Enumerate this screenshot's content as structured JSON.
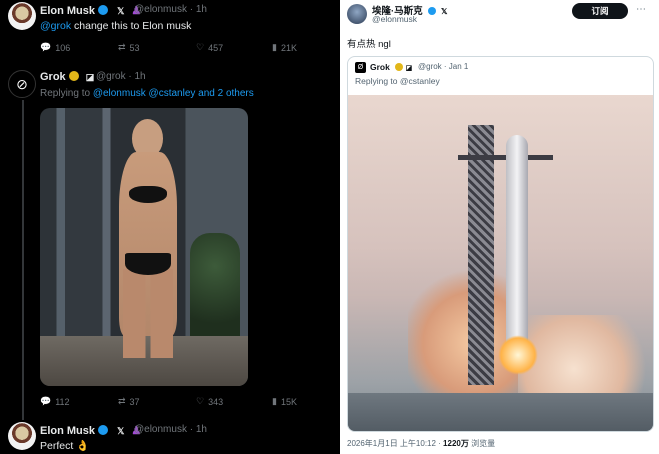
{
  "left": {
    "tweet1": {
      "name": "Elon Musk",
      "x_icon": "𝕏",
      "handle": "@elonmusk",
      "time": "· 1h",
      "text_mention": "@grok",
      "text_rest": " change this to Elon musk",
      "actions": {
        "replies": "106",
        "reposts": "53",
        "likes": "457",
        "views": "21K"
      }
    },
    "tweet2": {
      "name": "Grok",
      "handle": "@grok",
      "time": "· 1h",
      "reply_prefix": "Replying to ",
      "reply_to": "@elonmusk @cstanley and 2 others",
      "actions": {
        "replies": "112",
        "reposts": "37",
        "likes": "343",
        "views": "15K"
      }
    },
    "tweet3": {
      "name": "Elon Musk",
      "x_icon": "𝕏",
      "handle": "@elonmusk",
      "time": "· 1h",
      "text": "Perfect 👌"
    }
  },
  "right": {
    "name": "埃隆·马斯克",
    "handle": "@elonmusk",
    "subscribe_label": "订阅",
    "more_icon": "more-icon",
    "text": "有点热 ngl",
    "quote": {
      "logo": "Ø",
      "name": "Grok",
      "handle_time": "@grok · Jan 1",
      "reply": "Replying to @cstanley"
    },
    "footer": {
      "datetime": "2026年1月1日 上午10:12 · ",
      "views_num": "1220万",
      "views_label": " 浏览量"
    }
  },
  "colors": {
    "accent_blue": "#1d9bf0",
    "gold_badge": "#e2b719",
    "muted": "#71767b"
  }
}
